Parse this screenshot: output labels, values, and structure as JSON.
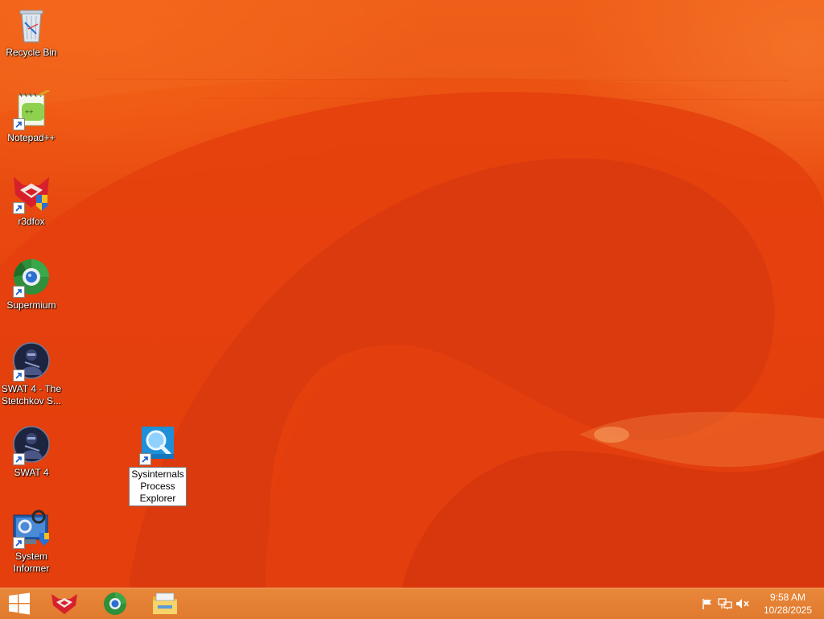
{
  "desktop": {
    "icons": [
      {
        "label": "Recycle Bin"
      },
      {
        "label": "Notepad++"
      },
      {
        "label": "r3dfox"
      },
      {
        "label": "Supermium"
      },
      {
        "label": "SWAT 4 - The Stetchkov S..."
      },
      {
        "label": "SWAT 4"
      },
      {
        "label": "System Informer"
      },
      {
        "label": "Sysinternals Process Explorer"
      }
    ],
    "icon_names": [
      "recycle-bin-icon",
      "notepad-plus-plus-icon",
      "r3dfox-icon",
      "supermium-icon",
      "swat4-expansion-icon",
      "swat4-icon",
      "system-informer-icon",
      "process-explorer-icon"
    ]
  },
  "taskbar": {
    "pinned": [
      "r3dfox",
      "Supermium",
      "File Explorer"
    ]
  },
  "tray": {
    "icons": [
      "action-center-flag-icon",
      "network-icon",
      "volume-muted-icon"
    ],
    "time": "9:58 AM",
    "date": "10/28/2025"
  },
  "colors": {
    "wallpaper": "#e8420e",
    "taskbar": "#e07a2e",
    "selection": "#ffffff"
  }
}
